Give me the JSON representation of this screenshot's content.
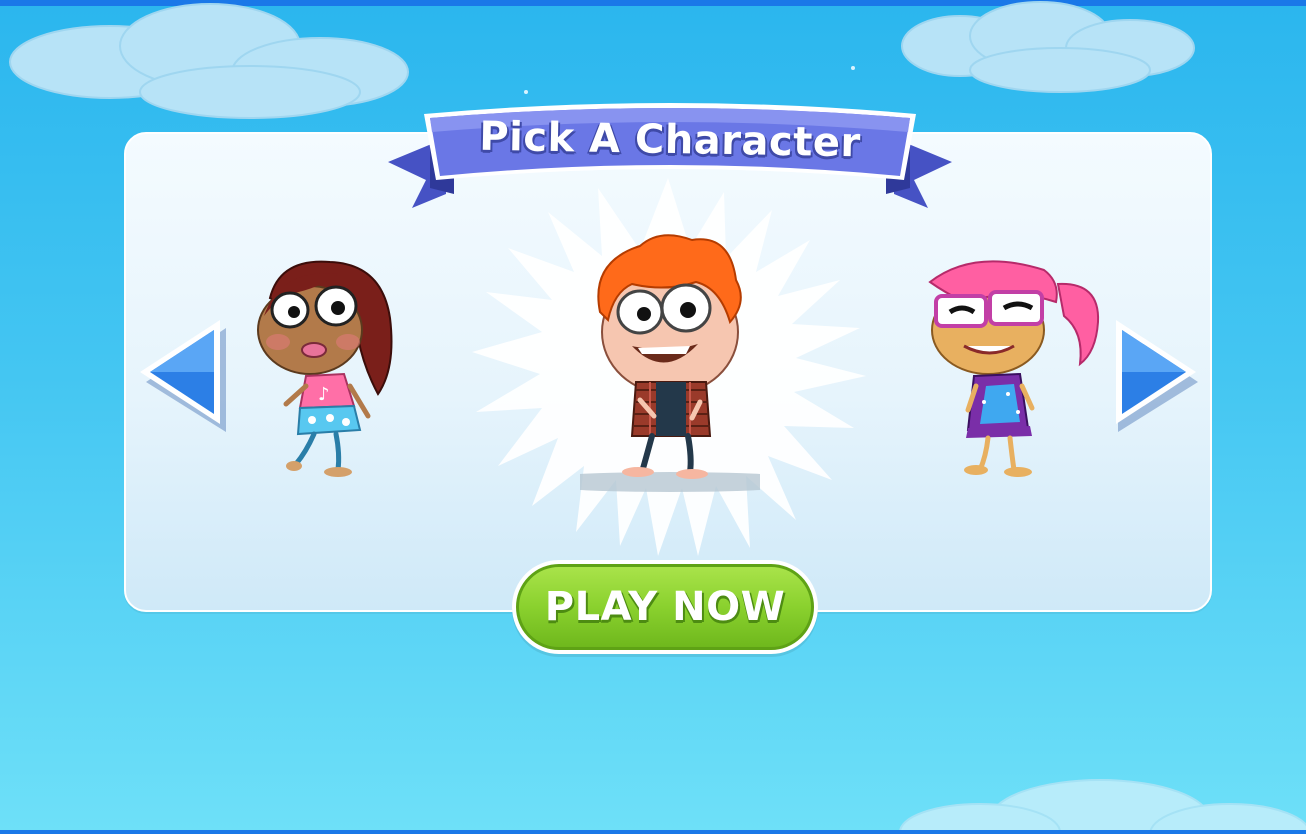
{
  "screen": {
    "title": "Pick A Character",
    "play_button": "PLAY NOW"
  },
  "carousel": {
    "characters": [
      {
        "position": "left",
        "hair": "brown",
        "top": "pink music-note shirt"
      },
      {
        "position": "center",
        "selected": true,
        "hair": "orange",
        "top": "plaid shirt"
      },
      {
        "position": "right",
        "hair": "pink",
        "top": "sparkly purple dress"
      }
    ],
    "prev_icon": "arrow-left-icon",
    "next_icon": "arrow-right-icon"
  },
  "colors": {
    "sky": "#2bb6ee",
    "ribbon": "#5b68d9",
    "arrow": "#2c7fe6",
    "play_button": "#8ad12e",
    "frame_bar": "#1a78e8"
  }
}
